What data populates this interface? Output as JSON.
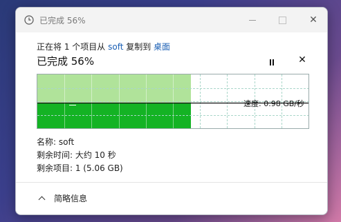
{
  "window": {
    "title": "已完成 56%",
    "close_glyph": "✕"
  },
  "copy_line": {
    "prefix": "正在将 1 个项目从 ",
    "source": "soft",
    "middle": " 复制到 ",
    "destination": "桌面"
  },
  "progress": {
    "title": "已完成 56%",
    "percent": 56,
    "cancel_glyph": "✕"
  },
  "speed": {
    "label": "速度: 0.98 GB/秒"
  },
  "details": {
    "name": "名称: soft",
    "time_left": "剩余时间: 大约 10 秒",
    "items_left": "剩余项目: 1 (5.06 GB)"
  },
  "footer": {
    "toggle_label": "简略信息"
  },
  "colors": {
    "fill_light": "#b0e39a",
    "fill_dark": "#14b324",
    "grid": "#a9d6c9",
    "speed_line": "#111111",
    "link": "#1a5fb4"
  }
}
